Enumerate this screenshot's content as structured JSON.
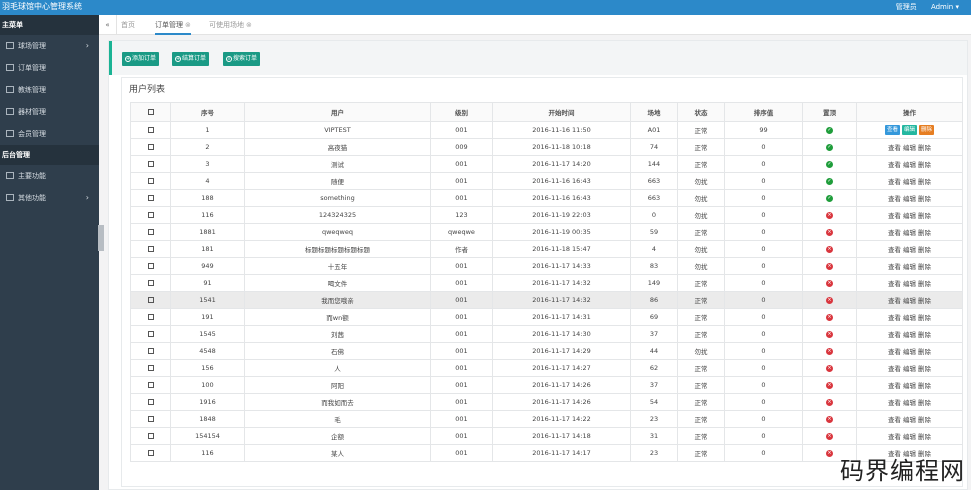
{
  "app": {
    "title": "羽毛球馆中心管理系统",
    "role_label": "管理员",
    "user": "Admin ▾"
  },
  "sidebar": {
    "main_header": "主菜单",
    "main_items": [
      {
        "label": "球场管理",
        "has_arrow": true
      },
      {
        "label": "订单管理",
        "has_arrow": false
      },
      {
        "label": "教练管理",
        "has_arrow": false
      },
      {
        "label": "器材管理",
        "has_arrow": false
      },
      {
        "label": "会员管理",
        "has_arrow": false
      }
    ],
    "admin_header": "后台管理",
    "admin_items": [
      {
        "label": "主要功能",
        "has_arrow": false
      },
      {
        "label": "其他功能",
        "has_arrow": true
      }
    ]
  },
  "tabs": {
    "back": "«",
    "items": [
      {
        "label": "首页",
        "closable": false
      },
      {
        "label": "订单管理",
        "closable": true
      },
      {
        "label": "可使用场地",
        "closable": true
      }
    ]
  },
  "toolbar": {
    "add": "添加订单",
    "summary": "结算订单",
    "search": "搜索订单"
  },
  "panel": {
    "title": "用户列表"
  },
  "table": {
    "headers": [
      "",
      "序号",
      "用户",
      "级别",
      "开始时间",
      "场地",
      "状态",
      "排序值",
      "置顶",
      "操作"
    ],
    "actions": {
      "view": "查看",
      "edit": "编辑",
      "delete": "删除"
    },
    "rows": [
      {
        "id": "1",
        "user": "VIPTEST",
        "level": "001",
        "time": "2016-11-16 11:50",
        "venue": "A01",
        "status": "正常",
        "sort": "99",
        "top": true
      },
      {
        "id": "2",
        "user": "高夜猫",
        "level": "009",
        "time": "2016-11-18 10:18",
        "venue": "74",
        "status": "正常",
        "sort": "0",
        "top": true
      },
      {
        "id": "3",
        "user": "测试",
        "level": "001",
        "time": "2016-11-17 14:20",
        "venue": "144",
        "status": "正常",
        "sort": "0",
        "top": true
      },
      {
        "id": "4",
        "user": "随便",
        "level": "001",
        "time": "2016-11-16 16:43",
        "venue": "663",
        "status": "勿扰",
        "sort": "0",
        "top": true
      },
      {
        "id": "188",
        "user": "something",
        "level": "001",
        "time": "2016-11-16 16:43",
        "venue": "663",
        "status": "勿扰",
        "sort": "0",
        "top": true
      },
      {
        "id": "116",
        "user": "124324325",
        "level": "123",
        "time": "2016-11-19 22:03",
        "venue": "0",
        "status": "勿扰",
        "sort": "0",
        "top": false
      },
      {
        "id": "1881",
        "user": "qweqweq",
        "level": "qweqwe",
        "time": "2016-11-19 00:35",
        "venue": "59",
        "status": "正常",
        "sort": "0",
        "top": false
      },
      {
        "id": "181",
        "user": "标题标题标题标题标题",
        "level": "作者",
        "time": "2016-11-18 15:47",
        "venue": "4",
        "status": "勿扰",
        "sort": "0",
        "top": false
      },
      {
        "id": "949",
        "user": "十五年",
        "level": "001",
        "time": "2016-11-17 14:33",
        "venue": "83",
        "status": "勿扰",
        "sort": "0",
        "top": false
      },
      {
        "id": "91",
        "user": "喝文件",
        "level": "001",
        "time": "2016-11-17 14:32",
        "venue": "149",
        "status": "正常",
        "sort": "0",
        "top": false
      },
      {
        "id": "1541",
        "user": "我而您哦亲",
        "level": "001",
        "time": "2016-11-17 14:32",
        "venue": "86",
        "status": "正常",
        "sort": "0",
        "top": false
      },
      {
        "id": "191",
        "user": "而wn额",
        "level": "001",
        "time": "2016-11-17 14:31",
        "venue": "69",
        "status": "正常",
        "sort": "0",
        "top": false
      },
      {
        "id": "1545",
        "user": "刘茜",
        "level": "001",
        "time": "2016-11-17 14:30",
        "venue": "37",
        "status": "正常",
        "sort": "0",
        "top": false
      },
      {
        "id": "4548",
        "user": "石佛",
        "level": "001",
        "time": "2016-11-17 14:29",
        "venue": "44",
        "status": "勿扰",
        "sort": "0",
        "top": false
      },
      {
        "id": "156",
        "user": "人",
        "level": "001",
        "time": "2016-11-17 14:27",
        "venue": "62",
        "status": "正常",
        "sort": "0",
        "top": false
      },
      {
        "id": "100",
        "user": "阿阳",
        "level": "001",
        "time": "2016-11-17 14:26",
        "venue": "37",
        "status": "正常",
        "sort": "0",
        "top": false
      },
      {
        "id": "1916",
        "user": "而我如而去",
        "level": "001",
        "time": "2016-11-17 14:26",
        "venue": "54",
        "status": "正常",
        "sort": "0",
        "top": false
      },
      {
        "id": "1848",
        "user": "毛",
        "level": "001",
        "time": "2016-11-17 14:22",
        "venue": "23",
        "status": "正常",
        "sort": "0",
        "top": false
      },
      {
        "id": "154154",
        "user": "企额",
        "level": "001",
        "time": "2016-11-17 14:18",
        "venue": "31",
        "status": "正常",
        "sort": "0",
        "top": false
      },
      {
        "id": "116",
        "user": "某人",
        "level": "001",
        "time": "2016-11-17 14:17",
        "venue": "23",
        "status": "正常",
        "sort": "0",
        "top": false
      }
    ]
  },
  "watermark": "码界编程网",
  "colors": {
    "topbar": "#2c89c9",
    "sidebar": "#2f3e4c",
    "button": "#1a9a85",
    "top_yes": "#1f9d3b",
    "top_no": "#d9363e"
  }
}
